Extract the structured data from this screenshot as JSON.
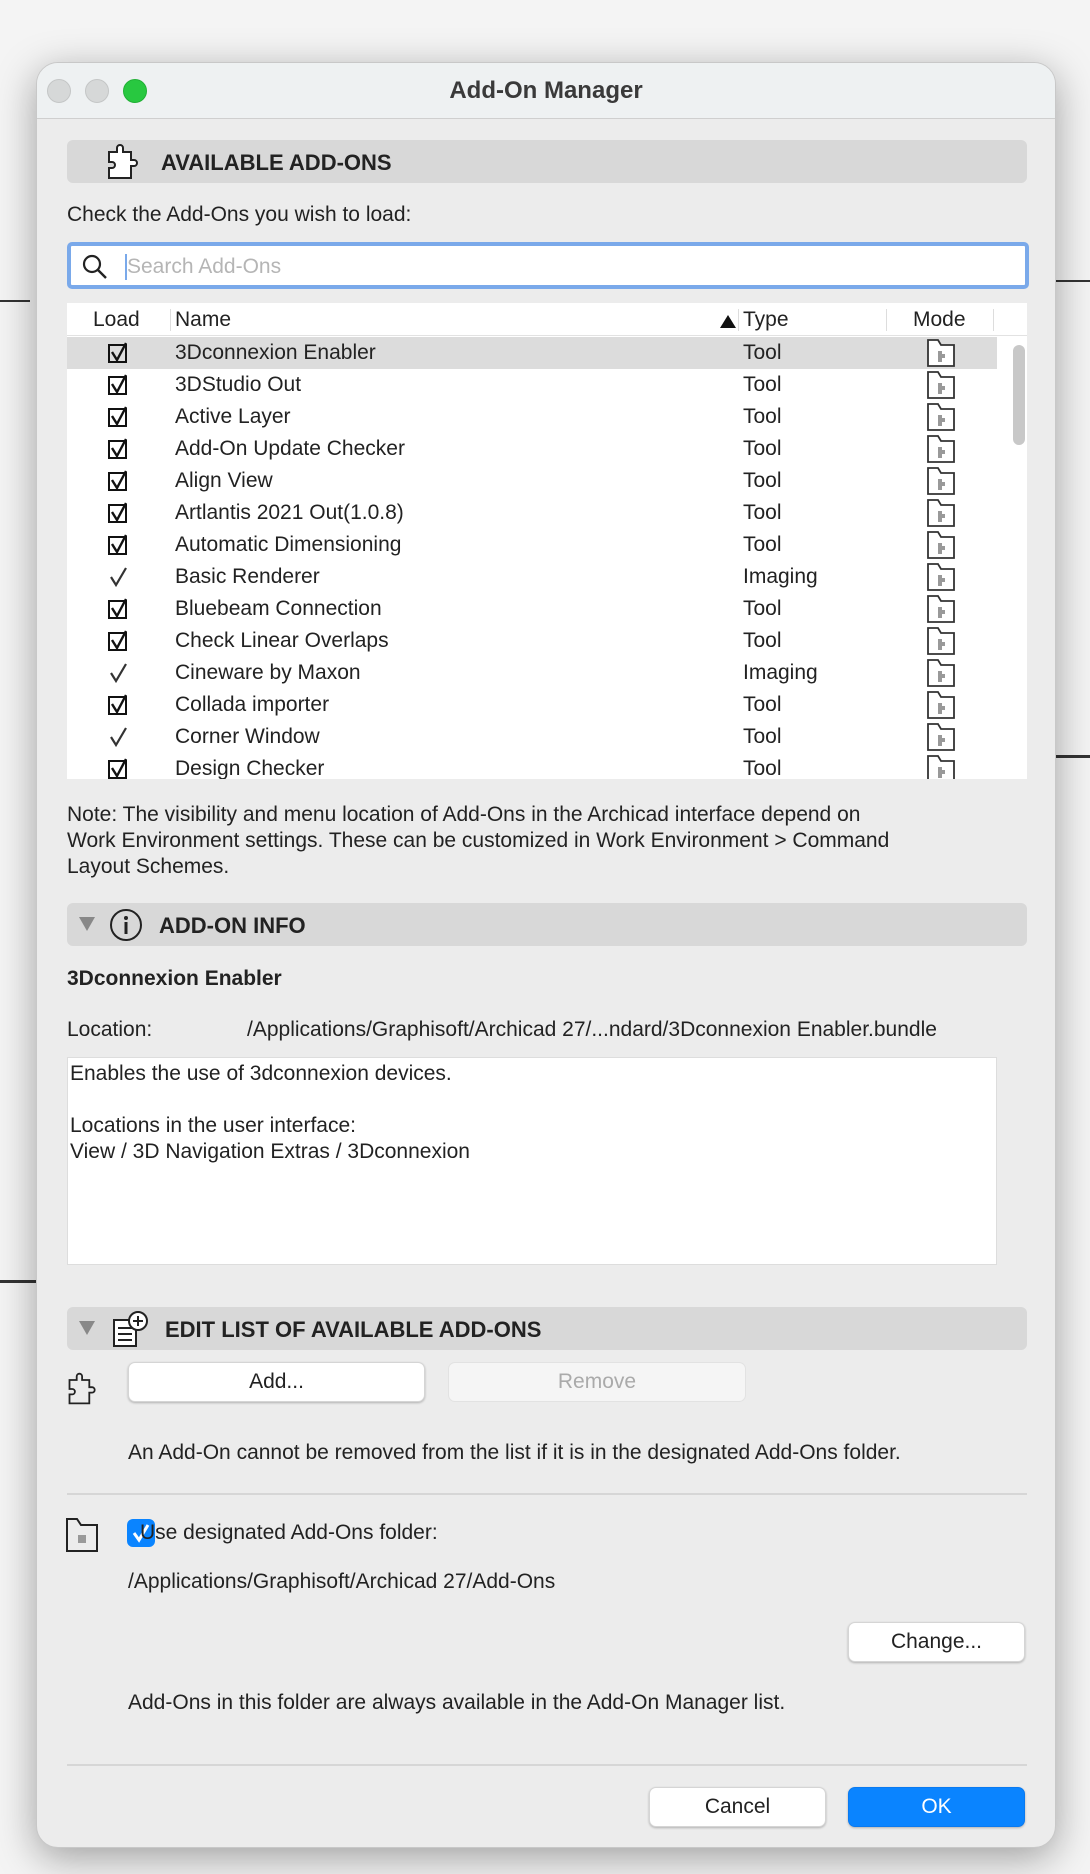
{
  "window": {
    "title": "Add-On Manager"
  },
  "available": {
    "title": "AVAILABLE ADD-ONS",
    "instruction": "Check the Add-Ons you wish to load:",
    "search_placeholder": "Search Add-Ons",
    "columns": {
      "load": "Load",
      "name": "Name",
      "type": "Type",
      "mode": "Mode",
      "sort": "ascending by Name"
    },
    "rows": [
      {
        "name": "3Dconnexion Enabler",
        "type": "Tool",
        "load": "checkbox-checked",
        "selected": true
      },
      {
        "name": "3DStudio Out",
        "type": "Tool",
        "load": "checkbox-checked"
      },
      {
        "name": "Active Layer",
        "type": "Tool",
        "load": "checkbox-checked"
      },
      {
        "name": "Add-On Update Checker",
        "type": "Tool",
        "load": "checkbox-checked"
      },
      {
        "name": "Align View",
        "type": "Tool",
        "load": "checkbox-checked"
      },
      {
        "name": "Artlantis 2021 Out(1.0.8)",
        "type": "Tool",
        "load": "checkbox-checked"
      },
      {
        "name": "Automatic Dimensioning",
        "type": "Tool",
        "load": "checkbox-checked"
      },
      {
        "name": "Basic Renderer",
        "type": "Imaging",
        "load": "always-loaded"
      },
      {
        "name": "Bluebeam Connection",
        "type": "Tool",
        "load": "checkbox-checked"
      },
      {
        "name": "Check Linear Overlaps",
        "type": "Tool",
        "load": "checkbox-checked"
      },
      {
        "name": "Cineware by Maxon",
        "type": "Imaging",
        "load": "always-loaded"
      },
      {
        "name": "Collada importer",
        "type": "Tool",
        "load": "checkbox-checked"
      },
      {
        "name": "Corner Window",
        "type": "Tool",
        "load": "always-loaded"
      },
      {
        "name": "Design Checker",
        "type": "Tool",
        "load": "checkbox-checked"
      }
    ],
    "note": [
      "Note: The visibility and menu location of Add-Ons in the Archicad interface depend on",
      "Work Environment settings. These can be customized in Work Environment > Command",
      "Layout Schemes."
    ]
  },
  "info": {
    "title": "ADD-ON INFO",
    "name": "3Dconnexion Enabler",
    "location_label": "Location:",
    "location_value": "/Applications/Graphisoft/Archicad 27/...ndard/3Dconnexion Enabler.bundle",
    "description": [
      "Enables the use of 3dconnexion devices.",
      "",
      "Locations in the user interface:",
      "View / 3D Navigation Extras / 3Dconnexion"
    ]
  },
  "edit": {
    "title": "EDIT LIST OF AVAILABLE ADD-ONS",
    "add_label": "Add...",
    "remove_label": "Remove",
    "remove_note": "An Add-On cannot be removed from the list if it is in the designated Add-Ons folder.",
    "use_folder_label": "Use designated Add-Ons folder:",
    "use_folder_checked": true,
    "folder_path": "/Applications/Graphisoft/Archicad 27/Add-Ons",
    "change_label": "Change...",
    "folder_note": "Add-Ons in this folder are always available in the Add-On Manager list."
  },
  "footer": {
    "cancel_label": "Cancel",
    "ok_label": "OK"
  },
  "colors": {
    "accent": "#0a84ff",
    "zoom_light": "#28c840",
    "search_focus": "#7aa9ea"
  }
}
